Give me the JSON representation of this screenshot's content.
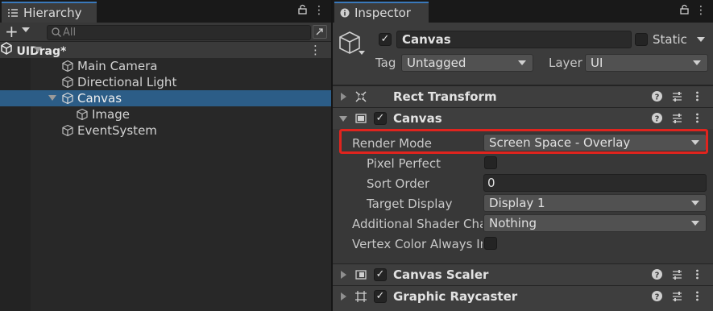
{
  "hierarchy": {
    "tab_label": "Hierarchy",
    "search_placeholder": "All",
    "scene_name": "UIDrag*",
    "items": [
      {
        "label": "Main Camera"
      },
      {
        "label": "Directional Light"
      },
      {
        "label": "Canvas"
      },
      {
        "label": "Image"
      },
      {
        "label": "EventSystem"
      }
    ],
    "selected_item": "Canvas"
  },
  "inspector": {
    "tab_label": "Inspector",
    "object_name": "Canvas",
    "static_label": "Static",
    "tag_label": "Tag",
    "tag_value": "Untagged",
    "layer_label": "Layer",
    "layer_value": "UI",
    "components": {
      "rect_transform": "Rect Transform",
      "canvas": "Canvas",
      "canvas_scaler": "Canvas Scaler",
      "graphic_raycaster": "Graphic Raycaster"
    },
    "canvas_props": {
      "render_mode_label": "Render Mode",
      "render_mode_value": "Screen Space - Overlay",
      "pixel_perfect_label": "Pixel Perfect",
      "sort_order_label": "Sort Order",
      "sort_order_value": "0",
      "target_display_label": "Target Display",
      "target_display_value": "Display 1",
      "shader_channels_label": "Additional Shader Chan",
      "shader_channels_value": "Nothing",
      "vertex_color_label": "Vertex Color Always In"
    }
  },
  "colors": {
    "selection": "#2c5d87",
    "tab_accent": "#3a79bb",
    "highlight_box": "#e0241e"
  }
}
